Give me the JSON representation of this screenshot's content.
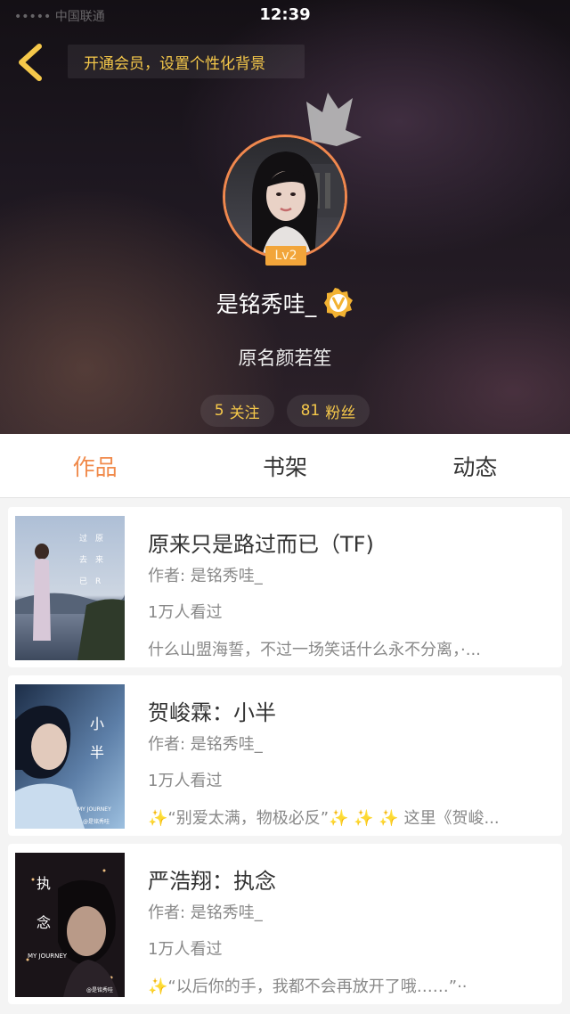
{
  "status_bar": {
    "time": "12:39",
    "carrier": "••••• 中国联通"
  },
  "header": {
    "vip_banner": "开通会员，设置个性化背景",
    "level": "Lv2",
    "username": "是铭秀哇_",
    "bio": "原名颜若笙",
    "following_count": "5",
    "following_label": "关注",
    "followers_count": "81",
    "followers_label": "粉丝"
  },
  "tabs": [
    {
      "label": "作品",
      "active": true
    },
    {
      "label": "书架",
      "active": false
    },
    {
      "label": "动态",
      "active": false
    }
  ],
  "works": [
    {
      "title": "原来只是路过而已（TF)",
      "author": "作者: 是铭秀哇_",
      "views": "1万人看过",
      "desc": "什么山盟海誓，不过一场笑话什么永不分离，·...",
      "cover_text": [
        "过",
        "原",
        "去",
        "来",
        "已",
        "R"
      ]
    },
    {
      "title": "贺峻霖：小半",
      "author": "作者: 是铭秀哇_",
      "views": "1万人看过",
      "desc_prefix": "✨",
      "desc": "“别爱太满，物极必反”✨ ✨ ✨ 这里《贺峻...",
      "cover_text": [
        "小",
        "半",
        "MY JOURNEY",
        "@是铭秀哇"
      ]
    },
    {
      "title": "严浩翔：执念",
      "author": "作者: 是铭秀哇_",
      "views": "1万人看过",
      "desc_prefix": "✨",
      "desc": "“以后你的手，我都不会再放开了哦……”··",
      "cover_text": [
        "执",
        "念",
        "MY JOURNEY",
        "@是铭秀哇"
      ]
    }
  ],
  "colors": {
    "accent": "#f08a4b",
    "gold": "#f5c84a",
    "level_badge": "#f2a53a"
  }
}
